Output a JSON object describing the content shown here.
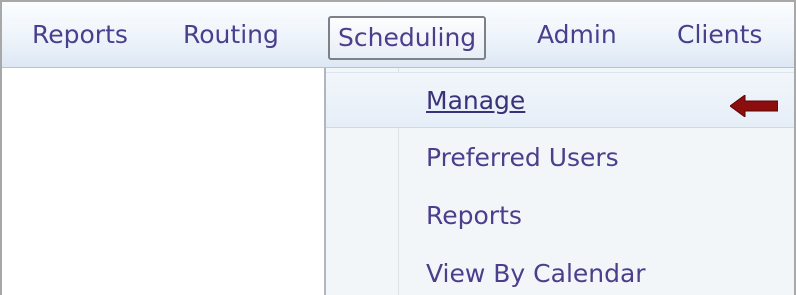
{
  "menubar": {
    "items": [
      {
        "label": "Reports"
      },
      {
        "label": "Routing"
      },
      {
        "label": "Scheduling",
        "active": true
      },
      {
        "label": "Admin"
      },
      {
        "label": "Clients"
      }
    ]
  },
  "dropdown": {
    "items": [
      {
        "label": "Manage",
        "highlighted": true
      },
      {
        "label": "Preferred Users"
      },
      {
        "label": "Reports"
      },
      {
        "label": "View By Calendar"
      }
    ]
  },
  "annotation": {
    "icon": "arrow-left-icon",
    "color": "#8b0d0d"
  },
  "colors": {
    "menu_text": "#4a3f8c",
    "menubar_background": "#eef4fb",
    "dropdown_background": "#f3f6f9"
  }
}
